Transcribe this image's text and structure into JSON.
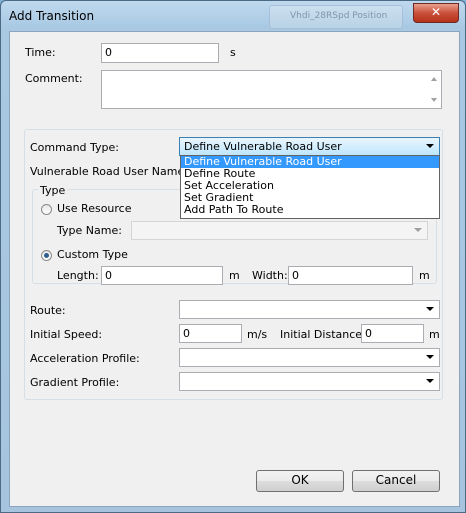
{
  "window": {
    "title": "Add Transition",
    "close_glyph": "✕",
    "background_tab_text": "Vhdi_28RSpd Position"
  },
  "fields": {
    "time": {
      "label": "Time:",
      "value": "0",
      "unit": "s"
    },
    "comment": {
      "label": "Comment:",
      "value": ""
    },
    "command_type": {
      "label": "Command Type:",
      "selected": "Define Vulnerable Road User"
    },
    "vru_name": {
      "label": "Vulnerable Road User Name:"
    },
    "type_group": {
      "label": "Type",
      "use_resource": {
        "label": "Use Resource",
        "checked": false
      },
      "type_name": {
        "label": "Type Name:",
        "value": ""
      },
      "custom_type": {
        "label": "Custom Type",
        "checked": true
      },
      "length": {
        "label": "Length:",
        "value": "0",
        "unit": "m"
      },
      "width": {
        "label": "Width:",
        "value": "0",
        "unit": "m"
      }
    },
    "route": {
      "label": "Route:",
      "value": ""
    },
    "initial_speed": {
      "label": "Initial Speed:",
      "value": "0",
      "unit": "m/s"
    },
    "initial_distance": {
      "label": "Initial Distance:",
      "value": "0",
      "unit": "m"
    },
    "acceleration_profile": {
      "label": "Acceleration Profile:",
      "value": ""
    },
    "gradient_profile": {
      "label": "Gradient Profile:",
      "value": ""
    }
  },
  "dropdown": {
    "options": [
      "Define Vulnerable Road User",
      "Define Route",
      "Set Acceleration",
      "Set Gradient",
      "Add Path To Route"
    ],
    "selected_index": 0
  },
  "buttons": {
    "ok": "OK",
    "cancel": "Cancel"
  },
  "colors": {
    "selection": "#3399ff",
    "title_gradient": "#bfd9ee",
    "close_button": "#c8503a"
  }
}
